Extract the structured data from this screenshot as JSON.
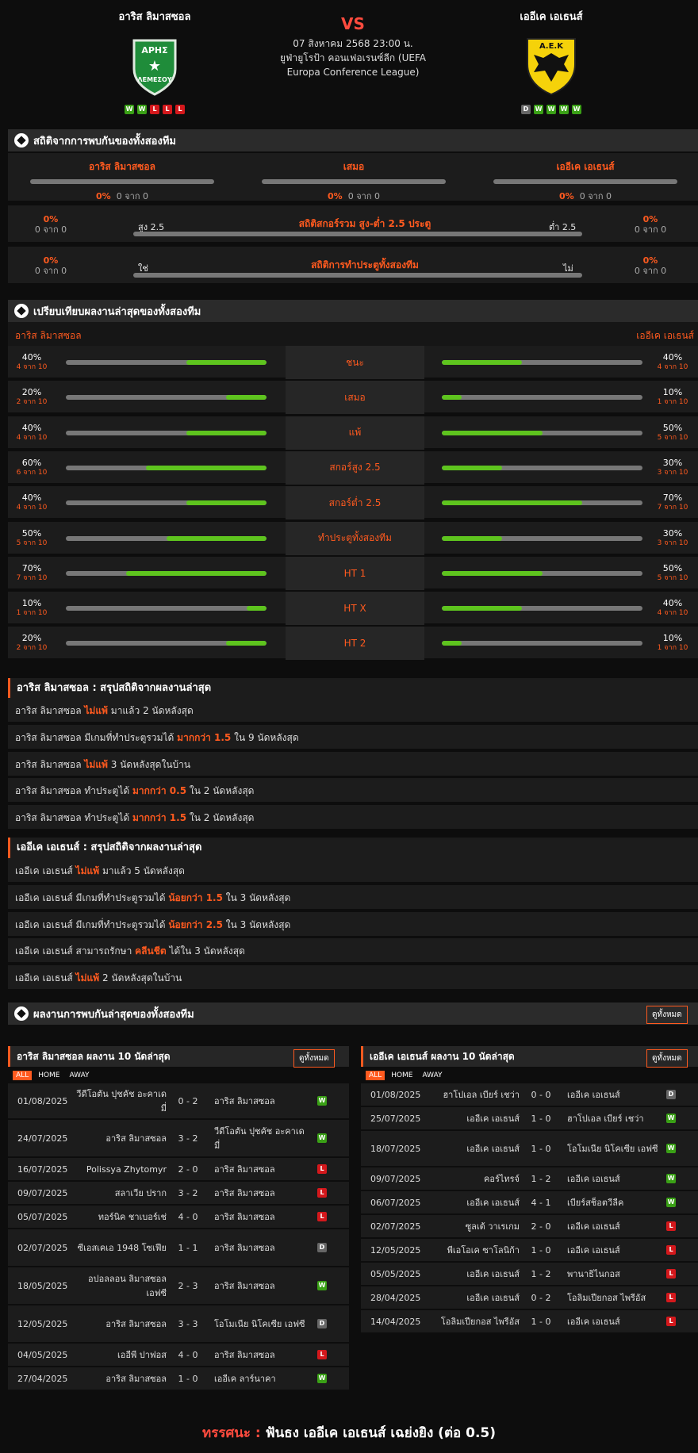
{
  "match": {
    "home": "อาริส ลิมาสซอล",
    "away": "เออีเค เอเธนส์",
    "vs": "VS",
    "date": "07 สิงหาคม 2568 23:00 น.",
    "competition": "ยูฟ่ายูโรป้า คอนเฟอเรนซ์ลีก (UEFA Europa Conference League)",
    "home_form": [
      "W",
      "W",
      "L",
      "L",
      "L"
    ],
    "away_form": [
      "D",
      "W",
      "W",
      "W",
      "W"
    ],
    "home_logo_text": "ΑΡΗΣ",
    "home_logo_sub": "ΛΕΜΕΣΟΥ",
    "away_logo_text": "Α.Ε.Κ"
  },
  "h2h": {
    "title": "สถิติจากการพบกันของทั้งสองทีม",
    "home": "อาริส ลิมาสซอล",
    "draw": "เสมอ",
    "away": "เออีเค เอเธนส์",
    "home_pct": "0%",
    "home_of": "0 จาก 0",
    "draw_pct": "0%",
    "draw_of": "0 จาก 0",
    "away_pct": "0%",
    "away_of": "0 จาก 0",
    "ou_title": "สถิติสกอร์รวม สูง-ต่ำ 2.5 ประตู",
    "ou_left_label": "สูง 2.5",
    "ou_right_label": "ต่ำ 2.5",
    "ou_left_pct": "0%",
    "ou_left_of": "0 จาก 0",
    "ou_right_pct": "0%",
    "ou_right_of": "0 จาก 0",
    "btts_title": "สถิติการทำประตูทั้งสองทีม",
    "btts_left_label": "ใช่",
    "btts_right_label": "ไม่",
    "btts_left_pct": "0%",
    "btts_left_of": "0 จาก 0",
    "btts_right_pct": "0%",
    "btts_right_of": "0 จาก 0"
  },
  "compare": {
    "title": "เปรียบเทียบผลงานล่าสุดของทั้งสองทีม",
    "home": "อาริส ลิมาสซอล",
    "away": "เออีเค เอเธนส์",
    "rows": [
      {
        "label": "ชนะ",
        "hp": "40%",
        "hof": "4 จาก 10",
        "hv": 0.4,
        "ap": "40%",
        "aof": "4 จาก 10",
        "av": 0.4
      },
      {
        "label": "เสมอ",
        "hp": "20%",
        "hof": "2 จาก 10",
        "hv": 0.2,
        "ap": "10%",
        "aof": "1 จาก 10",
        "av": 0.1
      },
      {
        "label": "แพ้",
        "hp": "40%",
        "hof": "4 จาก 10",
        "hv": 0.4,
        "ap": "50%",
        "aof": "5 จาก 10",
        "av": 0.5
      },
      {
        "label": "สกอร์สูง 2.5",
        "hp": "60%",
        "hof": "6 จาก 10",
        "hv": 0.6,
        "ap": "30%",
        "aof": "3 จาก 10",
        "av": 0.3
      },
      {
        "label": "สกอร์ต่ำ 2.5",
        "hp": "40%",
        "hof": "4 จาก 10",
        "hv": 0.4,
        "ap": "70%",
        "aof": "7 จาก 10",
        "av": 0.7
      },
      {
        "label": "ทำประตูทั้งสองทีม",
        "hp": "50%",
        "hof": "5 จาก 10",
        "hv": 0.5,
        "ap": "30%",
        "aof": "3 จาก 10",
        "av": 0.3
      },
      {
        "label": "HT 1",
        "hp": "70%",
        "hof": "7 จาก 10",
        "hv": 0.7,
        "ap": "50%",
        "aof": "5 จาก 10",
        "av": 0.5
      },
      {
        "label": "HT X",
        "hp": "10%",
        "hof": "1 จาก 10",
        "hv": 0.1,
        "ap": "40%",
        "aof": "4 จาก 10",
        "av": 0.4
      },
      {
        "label": "HT 2",
        "hp": "20%",
        "hof": "2 จาก 10",
        "hv": 0.2,
        "ap": "10%",
        "aof": "1 จาก 10",
        "av": 0.1
      }
    ]
  },
  "home_summary": {
    "title": "อาริส ลิมาสซอล : สรุปสถิติจากผลงานล่าสุด",
    "lines": [
      [
        "อาริส ลิมาสซอล ",
        "ไม่แพ้",
        " มาแล้ว 2 นัดหลังสุด"
      ],
      [
        "อาริส ลิมาสซอล  มีเกมที่ทำประตูรวมได้ ",
        "มากกว่า 1.5",
        " ใน 9 นัดหลังสุด"
      ],
      [
        "อาริส ลิมาสซอล ",
        "ไม่แพ้",
        " 3 นัดหลังสุดในบ้าน"
      ],
      [
        "อาริส ลิมาสซอล  ทำประตูได้ ",
        "มากกว่า 0.5",
        " ใน 2 นัดหลังสุด"
      ],
      [
        "อาริส ลิมาสซอล  ทำประตูได้ ",
        "มากกว่า 1.5",
        " ใน 2 นัดหลังสุด"
      ]
    ]
  },
  "away_summary": {
    "title": "เออีเค เอเธนส์ : สรุปสถิติจากผลงานล่าสุด",
    "lines": [
      [
        "เออีเค เอเธนส์ ",
        "ไม่แพ้",
        " มาแล้ว 5 นัดหลังสุด"
      ],
      [
        "เออีเค เอเธนส์  มีเกมที่ทำประตูรวมได้ ",
        "น้อยกว่า 1.5",
        " ใน 3 นัดหลังสุด"
      ],
      [
        "เออีเค เอเธนส์  มีเกมที่ทำประตูรวมได้ ",
        "น้อยกว่า 2.5",
        " ใน 3 นัดหลังสุด"
      ],
      [
        "เออีเค เอเธนส์  สามารถรักษา ",
        "คลีนชีต",
        " ได้ใน 3 นัดหลังสุด"
      ],
      [
        "เออีเค เอเธนส์ ",
        "ไม่แพ้",
        " 2 นัดหลังสุดในบ้าน"
      ]
    ]
  },
  "recent": {
    "title": "ผลงานการพบกันล่าสุดของทั้งสองทีม",
    "view_all": "ดูทั้งหมด",
    "home_title": "อาริส ลิมาสซอล ผลงาน 10 นัดล่าสุด",
    "away_title": "เออีเค เอเธนส์ ผลงาน 10 นัดล่าสุด",
    "tabs": [
      "ALL",
      "HOME",
      "AWAY"
    ],
    "home_matches": [
      {
        "date": "01/08/2025",
        "home": "วีดีโอตัน ปุชคัช อะคาเดมี่",
        "score": "0 - 2",
        "away": "อาริส ลิมาสซอล",
        "res": "W"
      },
      {
        "date": "24/07/2025",
        "home": "อาริส ลิมาสซอล",
        "score": "3 - 2",
        "away": "วีดีโอตัน ปุชคัช อะคาเดมี่",
        "res": "W"
      },
      {
        "date": "16/07/2025",
        "home": "Polissya Zhytomyr",
        "score": "2 - 0",
        "away": "อาริส ลิมาสซอล",
        "res": "L"
      },
      {
        "date": "09/07/2025",
        "home": "สลาเวีย ปราก",
        "score": "3 - 2",
        "away": "อาริส ลิมาสซอล",
        "res": "L"
      },
      {
        "date": "05/07/2025",
        "home": "ทอร์นิค ชาเบอร์เช่",
        "score": "4 - 0",
        "away": "อาริส ลิมาสซอล",
        "res": "L"
      },
      {
        "date": "02/07/2025",
        "home": "ซีเอสเคเอ 1948 โซเฟีย",
        "score": "1 - 1",
        "away": "อาริส ลิมาสซอล",
        "res": "D"
      },
      {
        "date": "18/05/2025",
        "home": "อปอลลอน ลิมาสซอล เอฟซี",
        "score": "2 - 3",
        "away": "อาริส ลิมาสซอล",
        "res": "W"
      },
      {
        "date": "12/05/2025",
        "home": "อาริส ลิมาสซอล",
        "score": "3 - 3",
        "away": "โอโมเนีย นิโคเซีย เอฟซี",
        "res": "D"
      },
      {
        "date": "04/05/2025",
        "home": "เออีพี ปาฟอส",
        "score": "4 - 0",
        "away": "อาริส ลิมาสซอล",
        "res": "L"
      },
      {
        "date": "27/04/2025",
        "home": "อาริส ลิมาสซอล",
        "score": "1 - 0",
        "away": "เออีเค ลาร์นาคา",
        "res": "W"
      }
    ],
    "away_matches": [
      {
        "date": "01/08/2025",
        "home": "ฮาโปเอล เบียร์ เชว่า",
        "score": "0 - 0",
        "away": "เออีเค เอเธนส์",
        "res": "D"
      },
      {
        "date": "25/07/2025",
        "home": "เออีเค เอเธนส์",
        "score": "1 - 0",
        "away": "ฮาโปเอล เบียร์ เชว่า",
        "res": "W"
      },
      {
        "date": "18/07/2025",
        "home": "เออีเค เอเธนส์",
        "score": "1 - 0",
        "away": "โอโมเนีย นิโคเซีย เอฟซี",
        "res": "W"
      },
      {
        "date": "09/07/2025",
        "home": "คอร์ไทรจ์",
        "score": "1 - 2",
        "away": "เออีเค เอเธนส์",
        "res": "W"
      },
      {
        "date": "06/07/2025",
        "home": "เออีเค เอเธนส์",
        "score": "4 - 1",
        "away": "เบียร์สช็อตวีลีค",
        "res": "W"
      },
      {
        "date": "02/07/2025",
        "home": "ซูลเต้ วาเรเกม",
        "score": "2 - 0",
        "away": "เออีเค เอเธนส์",
        "res": "L"
      },
      {
        "date": "12/05/2025",
        "home": "พีเอโอเค ซาโลนิก้า",
        "score": "1 - 0",
        "away": "เออีเค เอเธนส์",
        "res": "L"
      },
      {
        "date": "05/05/2025",
        "home": "เออีเค เอเธนส์",
        "score": "1 - 2",
        "away": "พานาธิไนกอส",
        "res": "L"
      },
      {
        "date": "28/04/2025",
        "home": "เออีเค เอเธนส์",
        "score": "0 - 2",
        "away": "โอลิมเปียกอส ไพรีอัส",
        "res": "L"
      },
      {
        "date": "14/04/2025",
        "home": "โอลิมเปียกอส ไพรีอัส",
        "score": "1 - 0",
        "away": "เออีเค เอเธนส์",
        "res": "L"
      }
    ]
  },
  "prediction": {
    "label": "ทรรศนะ :",
    "text": "ฟันธง เออีเค เอเธนส์ เฉย่งยิง (ต่อ 0.5)"
  },
  "colors": {
    "accent": "#ff5a1f",
    "win": "#3aa016",
    "loss": "#d4181c",
    "draw": "#666666",
    "bar_fill": "#5ec41e"
  }
}
